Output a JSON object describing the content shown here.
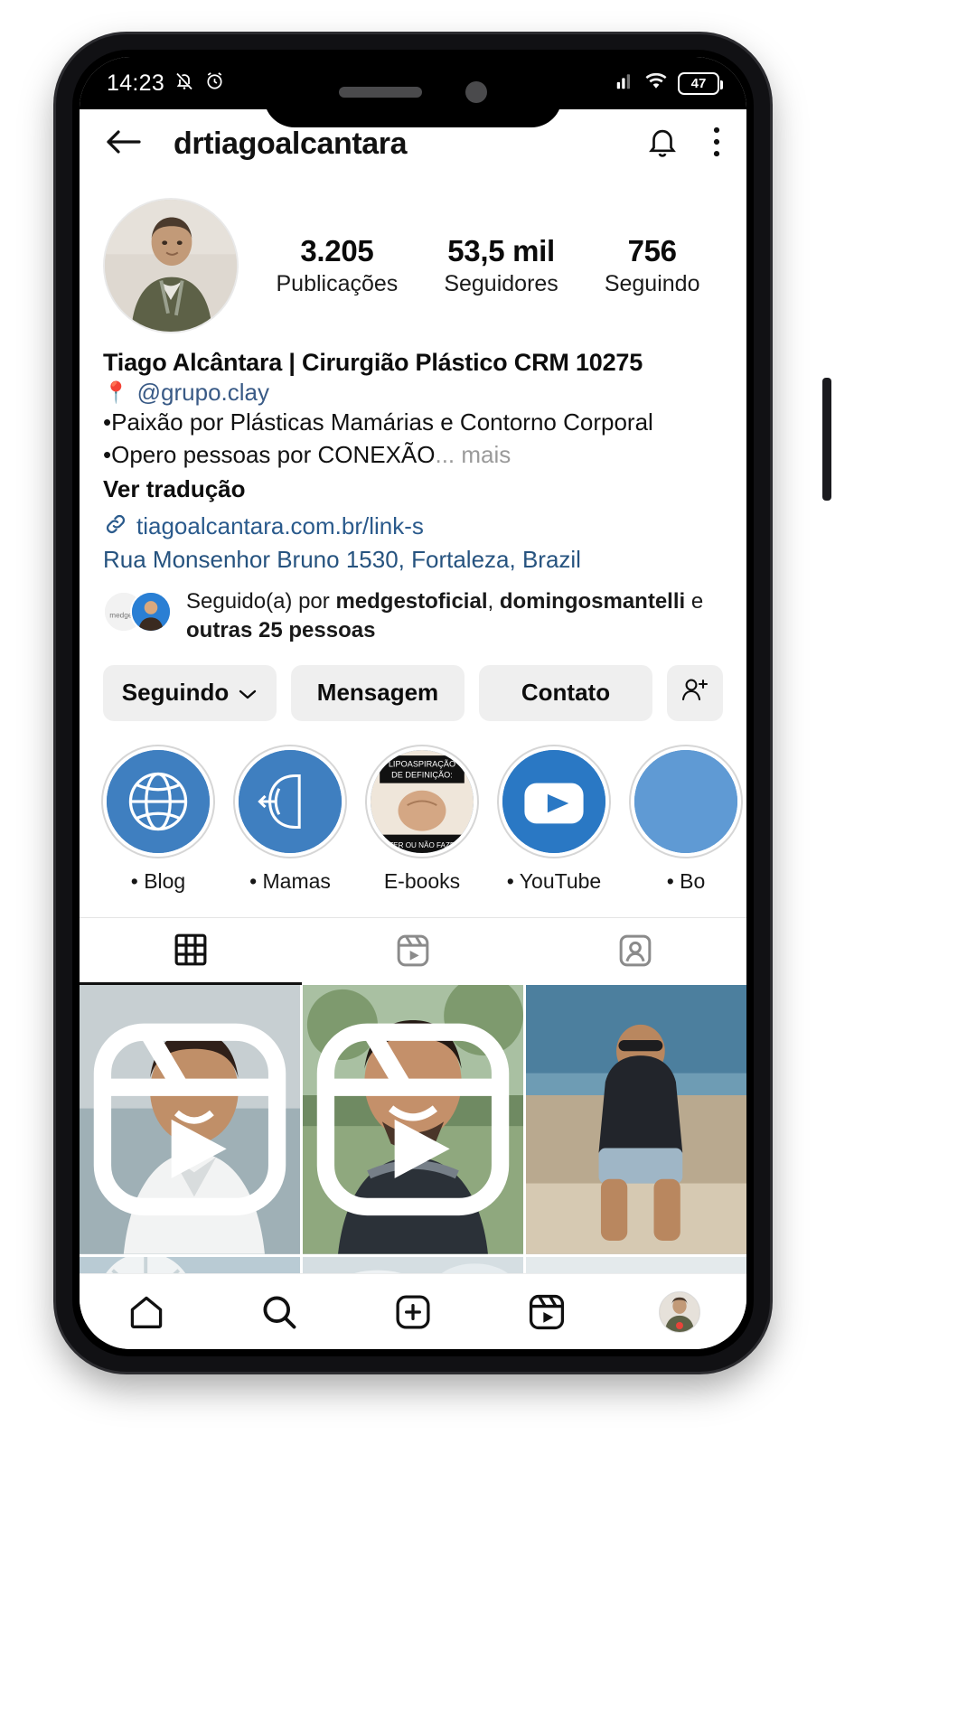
{
  "statusbar": {
    "time": "14:23",
    "icons": [
      "notification-off-icon",
      "alarm-icon",
      "signal-icon",
      "wifi-icon"
    ],
    "battery_level": "47"
  },
  "header": {
    "back_icon": "back-arrow-icon",
    "title": "drtiagoalcantara",
    "bell_icon": "bell-icon",
    "more_icon": "more-vertical-icon"
  },
  "profile": {
    "avatar_name": "profile-avatar",
    "stats": [
      {
        "value": "3.205",
        "label": "Publicações"
      },
      {
        "value": "53,5 mil",
        "label": "Seguidores"
      },
      {
        "value": "756",
        "label": "Seguindo"
      }
    ],
    "display_name": "Tiago Alcântara | Cirurgião Plástico CRM 10275",
    "pin_emoji": "📍",
    "category_handle": "@grupo.clay",
    "bio_line_1": "•Paixão por Plásticas Mamárias e Contorno Corporal",
    "bio_line_2": "•Opero pessoas por CONEXÃO",
    "bio_ellipsis": "...",
    "more_label": "mais",
    "translate_label": "Ver tradução",
    "website": "tiagoalcantara.com.br/link-s",
    "address": "Rua Monsenhor Bruno 1530, Fortaleza, Brazil",
    "followed_by_prefix": "Seguido(a) por ",
    "followed_by_1": "medgestoficial",
    "followed_by_sep": ", ",
    "followed_by_2": "domingosmantelli",
    "followed_by_suffix": " e",
    "followed_by_tail": "outras 25 pessoas"
  },
  "actions": [
    {
      "label": "Seguindo",
      "name": "following-button",
      "chevron": true
    },
    {
      "label": "Mensagem",
      "name": "message-button",
      "chevron": false
    },
    {
      "label": "Contato",
      "name": "contact-button",
      "chevron": false
    },
    {
      "label": "",
      "name": "add-person-button",
      "chevron": false,
      "icon": "add-person-icon"
    }
  ],
  "highlights": [
    {
      "label": "• Blog",
      "icon": "globe-icon"
    },
    {
      "label": "• Mamas",
      "icon": "breast-diagram-icon"
    },
    {
      "label": "E-books",
      "icon": "ebook-cover-icon"
    },
    {
      "label": "• YouTube",
      "icon": "youtube-play-icon"
    },
    {
      "label": "• Bo",
      "icon": "highlight-icon"
    }
  ],
  "tabs": [
    {
      "name": "tab-grid",
      "icon": "grid-icon",
      "active": true
    },
    {
      "name": "tab-reels",
      "icon": "reels-icon",
      "active": false
    },
    {
      "name": "tab-tagged",
      "icon": "tagged-icon",
      "active": false
    }
  ],
  "grid_posts": [
    {
      "name": "post-interview-white-shirt",
      "is_reel": true
    },
    {
      "name": "post-wetsuit-selfie",
      "is_reel": true
    },
    {
      "name": "post-seaside-sitting",
      "is_reel": false
    },
    {
      "name": "post-surgery-blue-cap",
      "is_reel": true
    },
    {
      "name": "post-operating-room",
      "is_reel": false
    },
    {
      "name": "post-surgery-team",
      "is_reel": true
    }
  ],
  "bottom_nav": [
    {
      "name": "nav-home",
      "icon": "home-icon"
    },
    {
      "name": "nav-search",
      "icon": "search-icon"
    },
    {
      "name": "nav-create",
      "icon": "plus-square-icon"
    },
    {
      "name": "nav-reels",
      "icon": "reels-icon"
    },
    {
      "name": "nav-profile",
      "icon": "profile-avatar-icon"
    }
  ],
  "colors": {
    "accent_blue": "#2a5a8c",
    "button_bg": "#efefef",
    "highlight_blue": "#3f7fc0",
    "notification_red": "#e8443a"
  }
}
